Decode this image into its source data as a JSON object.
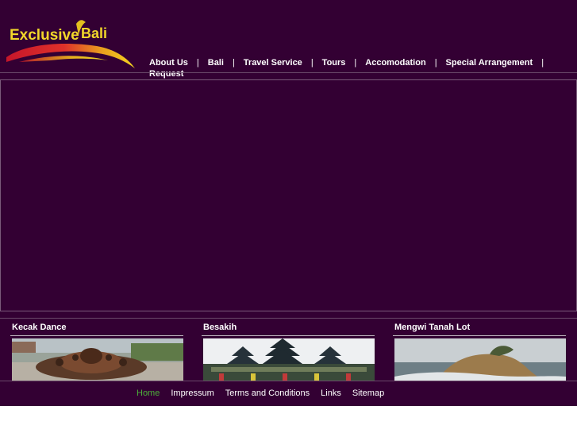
{
  "logo": {
    "text_left": "Exclusive",
    "text_right": "Bali"
  },
  "nav": {
    "items": [
      "About Us",
      "Bali",
      "Travel Service",
      "Tours",
      "Accomodation",
      "Special Arrangement",
      "Request"
    ],
    "separator": "|"
  },
  "cards": [
    {
      "title": "Kecak Dance"
    },
    {
      "title": "Besakih"
    },
    {
      "title": "Mengwi Tanah Lot"
    }
  ],
  "footer": {
    "links": [
      "Home",
      "Impressum",
      "Terms and Conditions",
      "Links",
      "Sitemap"
    ]
  },
  "colors": {
    "background": "#330033",
    "active_link": "#4caf3a"
  }
}
